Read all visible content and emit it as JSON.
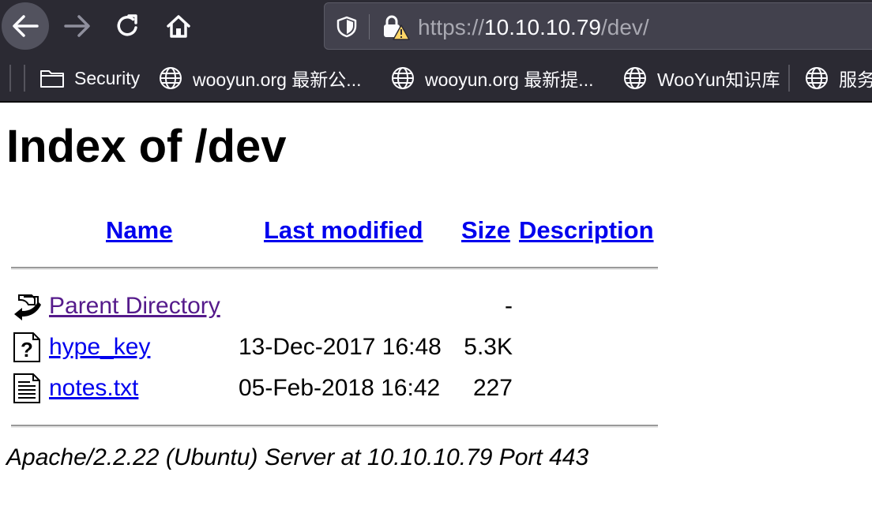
{
  "browser": {
    "url_scheme": "https://",
    "url_host": "10.10.10.79",
    "url_path": "/dev/",
    "nav_icons": [
      "back-arrow-icon",
      "forward-arrow-icon",
      "reload-icon",
      "home-icon"
    ],
    "bookmarks": [
      {
        "label": "Security",
        "icon": "folder-icon"
      },
      {
        "label": "wooyun.org 最新公...",
        "icon": "globe-icon"
      },
      {
        "label": "wooyun.org 最新提...",
        "icon": "globe-icon"
      },
      {
        "label": "WooYun知识库",
        "icon": "globe-icon"
      },
      {
        "label": "服务",
        "icon": "globe-icon"
      }
    ],
    "colors": {
      "chrome_bg": "#2b2a33",
      "urlbar_bg": "#42414d",
      "warning": "#ffd567"
    }
  },
  "page": {
    "title": "Index of /dev",
    "columns": {
      "name": "Name",
      "last_modified": "Last modified",
      "size": "Size",
      "description": "Description"
    },
    "rows": [
      {
        "name": "Parent Directory",
        "date": "",
        "size": "-",
        "icon": "back-folder-icon"
      },
      {
        "name": "hype_key",
        "date": "13-Dec-2017 16:48",
        "size": "5.3K",
        "icon": "unknown-file-icon"
      },
      {
        "name": "notes.txt",
        "date": "05-Feb-2018 16:42",
        "size": "227",
        "icon": "text-file-icon"
      }
    ],
    "address": "Apache/2.2.22 (Ubuntu) Server at 10.10.10.79 Port 443",
    "colors": {
      "link": "#0000ee",
      "visited": "#551a8b"
    }
  }
}
